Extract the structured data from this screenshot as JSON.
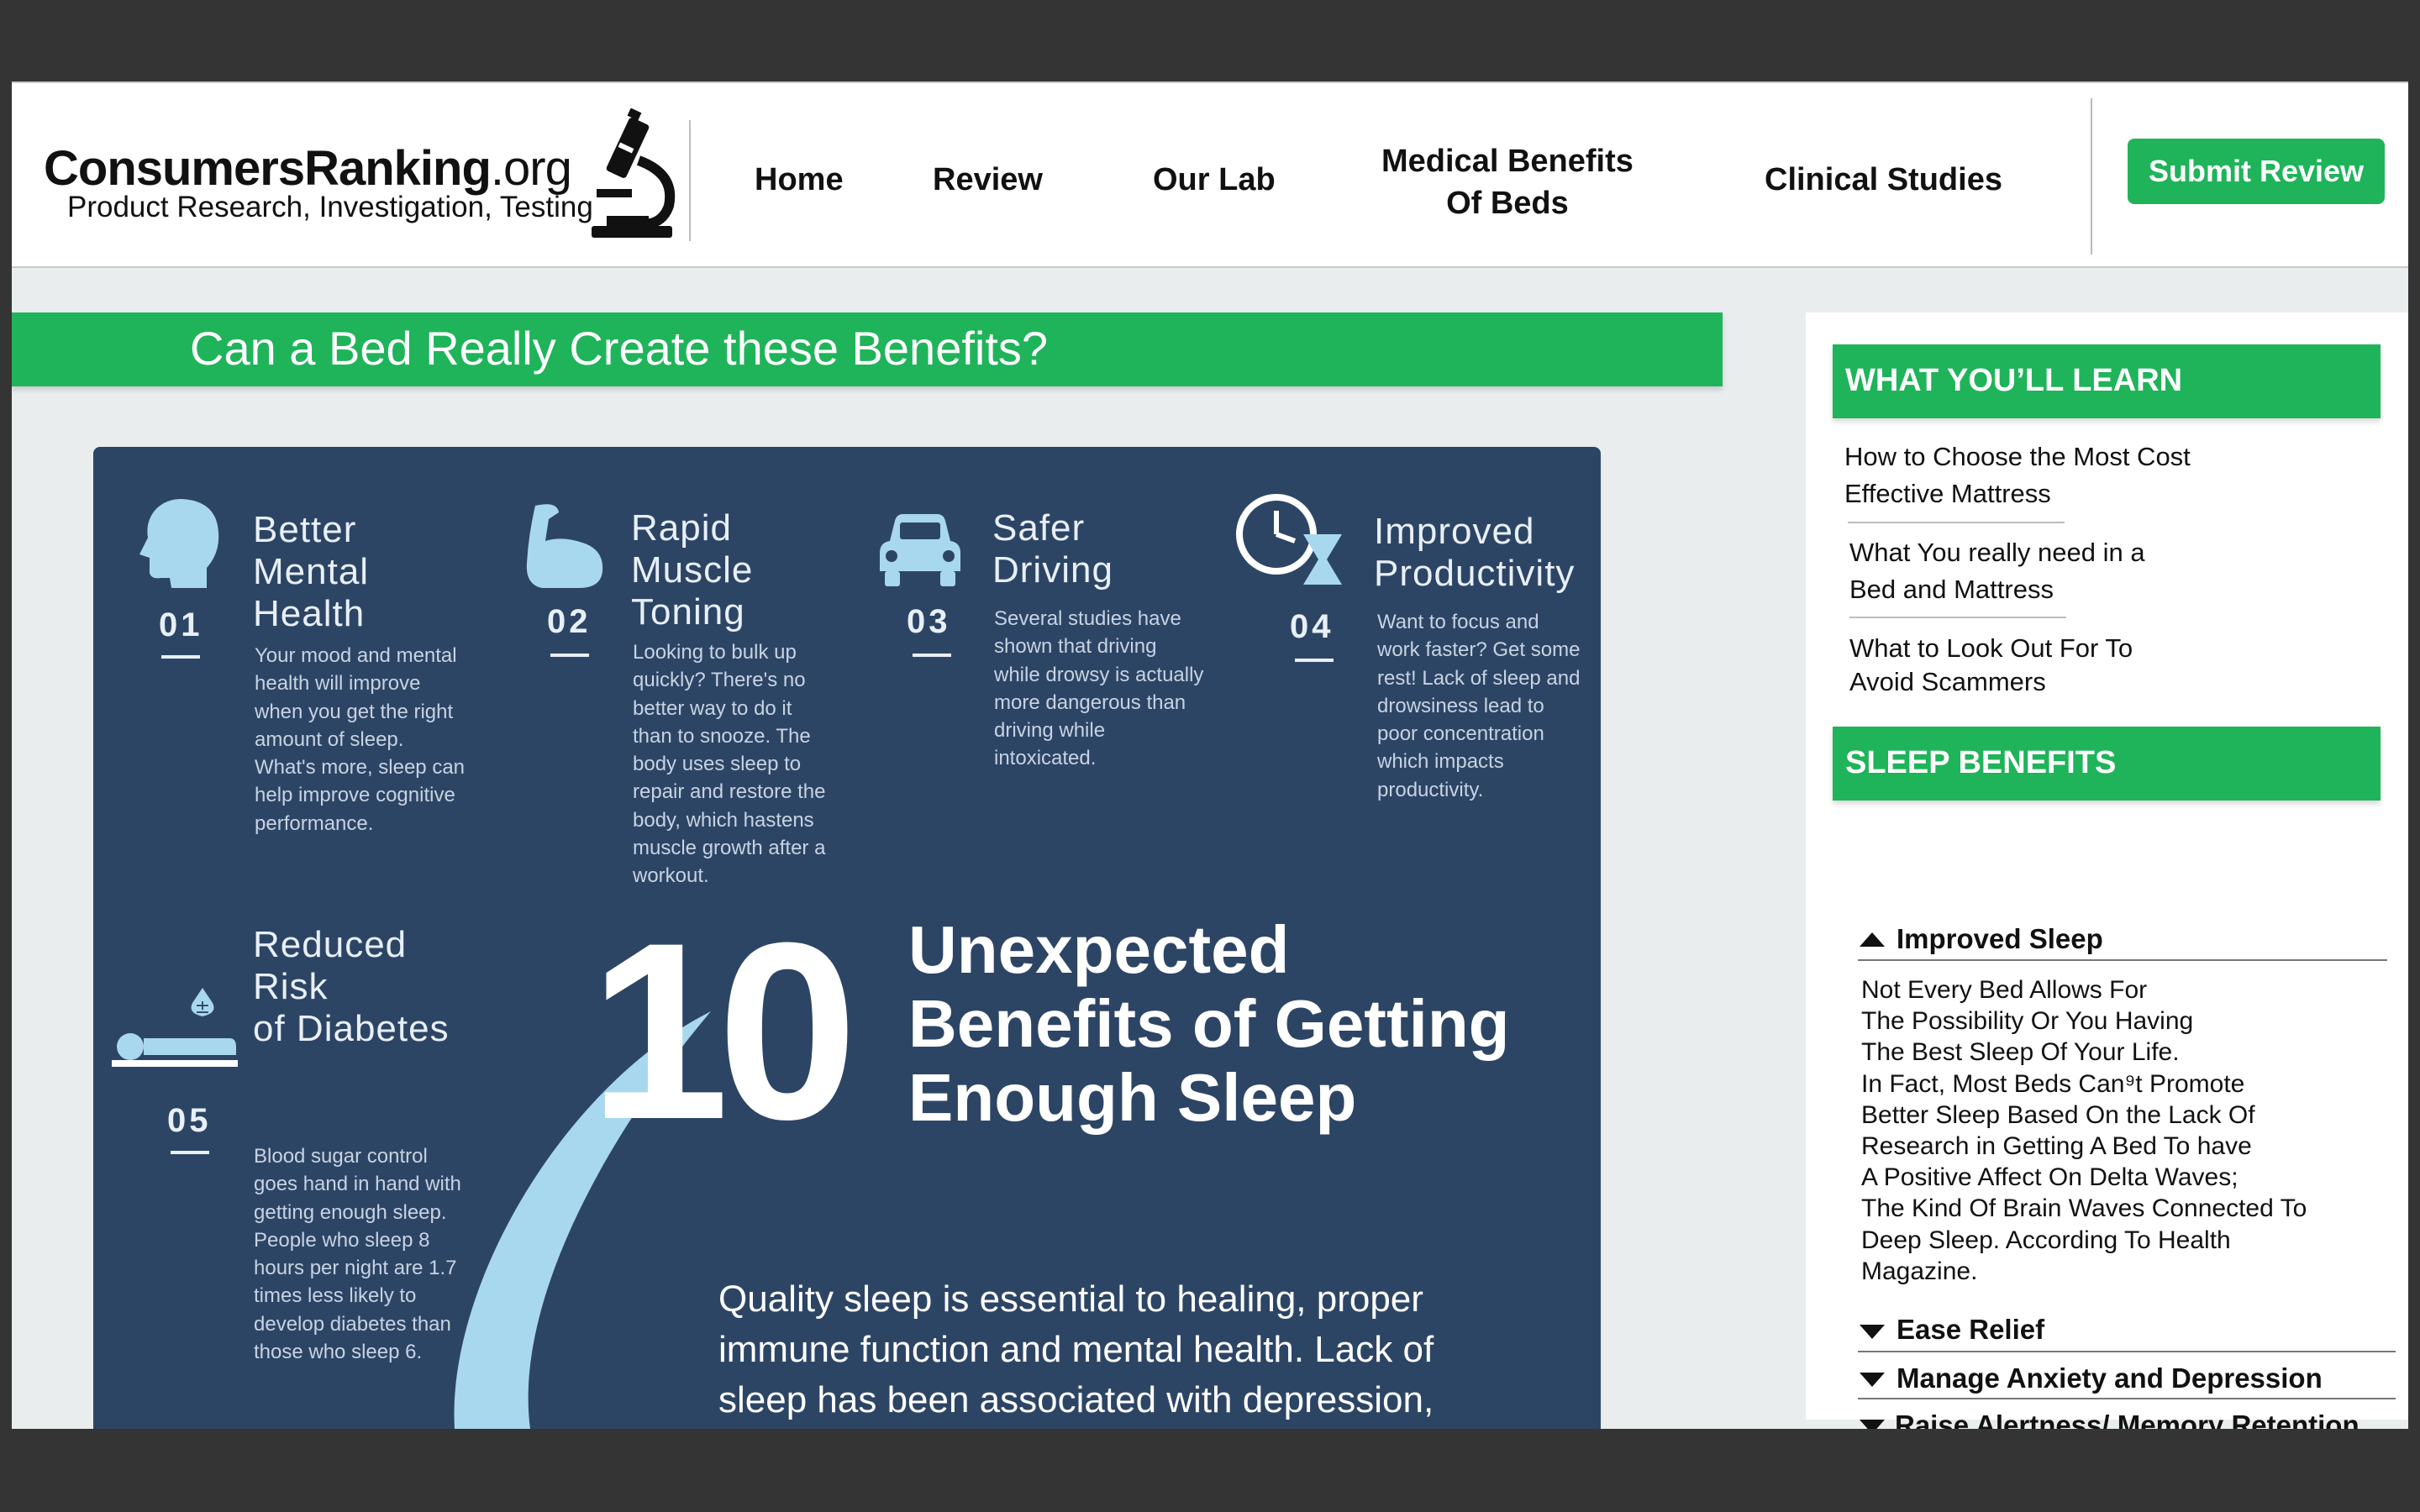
{
  "header": {
    "logo_name": "ConsumersRanking",
    "logo_tld": ".org",
    "logo_tagline": "Product Research, Investigation, Testing",
    "nav": [
      {
        "label": "Home"
      },
      {
        "label": "Review"
      },
      {
        "label": "Our Lab"
      },
      {
        "label": "Medical Benefits\nOf Beds"
      },
      {
        "label": "Clinical Studies"
      }
    ],
    "submit_label": "Submit Review"
  },
  "main": {
    "title": "Can a Bed Really Create these Benefits?"
  },
  "infographic": {
    "benefits": [
      {
        "num": "01",
        "title": "Better\nMental\nHealth",
        "icon": "brain-icon",
        "body": "Your mood and mental\nhealth will improve\nwhen you get the right\namount of sleep.\nWhat's more, sleep can\nhelp improve cognitive\nperformance."
      },
      {
        "num": "02",
        "title": "Rapid\nMuscle\nToning",
        "icon": "bicep-icon",
        "body": "Looking to bulk up\nquickly? There's no\nbetter way to do it\nthan to snooze. The\nbody uses sleep to\nrepair and restore the\nbody, which hastens\nmuscle growth after a\nworkout."
      },
      {
        "num": "03",
        "title": "Safer\nDriving",
        "icon": "car-icon",
        "body": "Several studies have\nshown that driving\nwhile drowsy is actually\nmore dangerous than\ndriving while\nintoxicated."
      },
      {
        "num": "04",
        "title": "Improved\nProductivity",
        "icon": "clock-hourglass-icon",
        "body": "Want to focus and\nwork faster? Get some\nrest! Lack of sleep and\ndrowsiness lead to\npoor concentration\nwhich impacts\nproductivity."
      },
      {
        "num": "05",
        "title": "Reduced\nRisk\nof Diabetes",
        "icon": "person-sleeping-icon",
        "body": "Blood sugar control\ngoes hand in hand with\ngetting enough sleep.\nPeople who sleep 8\nhours per night are 1.7\ntimes less likely to\ndevelop diabetes than\nthose who sleep 6."
      }
    ],
    "big_number": "10",
    "headline": "Unexpected\nBenefits of Getting\nEnough Sleep",
    "quality_text": "Quality sleep is essential to healing, proper\nimmune function and mental health. Lack of\nsleep has been associated with depression,"
  },
  "sidebar": {
    "learn_heading": "WHAT YOU’LL LEARN",
    "learn_links": [
      "How to Choose the Most Cost\nEffective Mattress",
      "What You really need in a\nBed and Mattress",
      "What to Look Out For To\nAvoid Scammers"
    ],
    "sleep_heading": "SLEEP BENEFITS",
    "accordion": [
      {
        "title": "Improved Sleep",
        "expanded": true,
        "body": "Not Every Bed Allows For\nThe Possibility Or You Having\nThe Best Sleep Of Your Life.\nIn Fact, Most Beds Can⁹t Promote\nBetter Sleep Based On the Lack Of\nResearch in Getting A Bed To have\nA Positive Affect On Delta Waves;\nThe Kind Of Brain Waves Connected To\nDeep Sleep. According To Health\nMagazine."
      },
      {
        "title": "Ease Relief",
        "expanded": false
      },
      {
        "title": "Manage Anxiety and Depression",
        "expanded": false
      },
      {
        "title": "Raise Alertness/ Memory Retention",
        "expanded": false
      }
    ]
  },
  "colors": {
    "accent_green": "#1fb45a",
    "infographic_navy": "#2d4565",
    "icon_light_blue": "#a8d8ee"
  }
}
